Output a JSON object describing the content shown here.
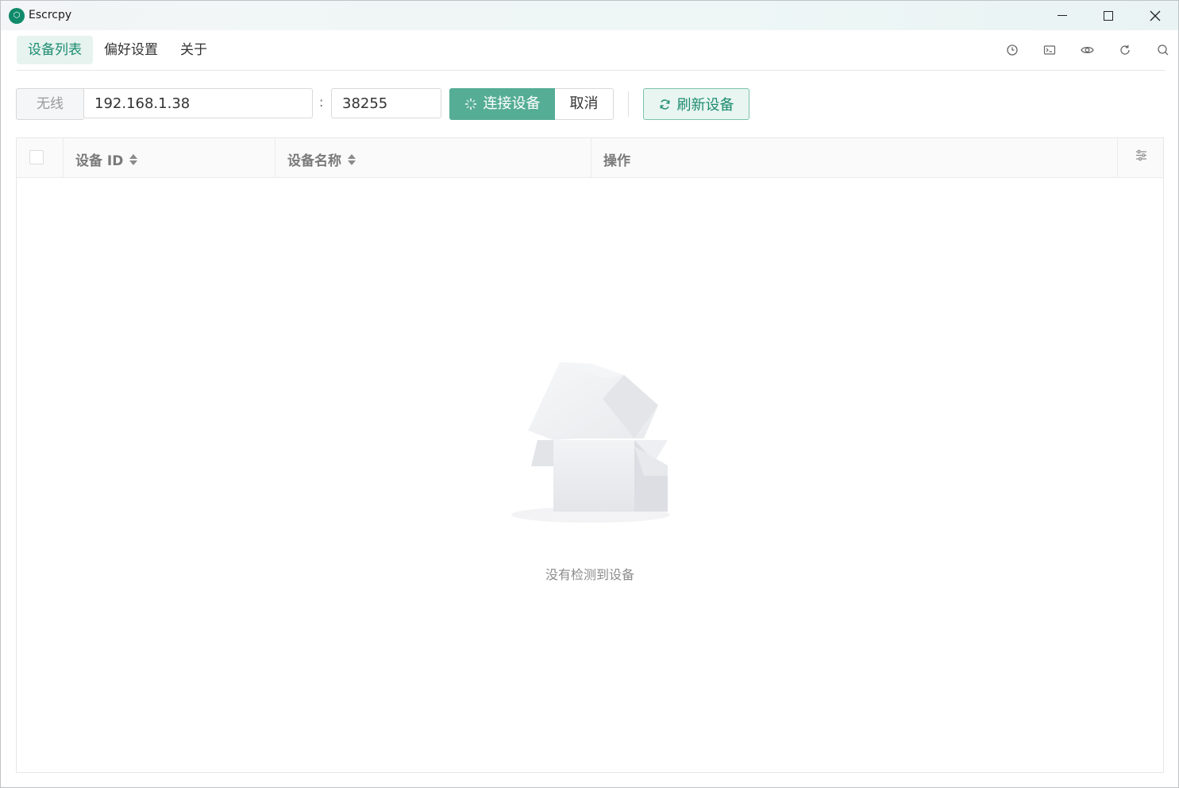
{
  "window": {
    "title": "Escrcpy",
    "icon": "app-logo-icon",
    "accent": "#1d8c6f"
  },
  "nav": {
    "tabs": [
      {
        "label": "设备列表",
        "active": true
      },
      {
        "label": "偏好设置",
        "active": false
      },
      {
        "label": "关于",
        "active": false
      }
    ],
    "icons": [
      "history-icon",
      "terminal-icon",
      "eye-icon",
      "refresh-icon",
      "search-icon"
    ]
  },
  "toolbar": {
    "mode_label": "无线",
    "ip_value": "192.168.1.38",
    "separator": ":",
    "port_value": "38255",
    "connect_label": "连接设备",
    "cancel_label": "取消",
    "refresh_label": "刷新设备",
    "connect_color": "#55ad95"
  },
  "table": {
    "columns": [
      {
        "label": "设备 ID",
        "sortable": true
      },
      {
        "label": "设备名称",
        "sortable": true
      },
      {
        "label": "操作",
        "sortable": false
      }
    ],
    "rows": [],
    "empty_text": "没有检测到设备"
  }
}
